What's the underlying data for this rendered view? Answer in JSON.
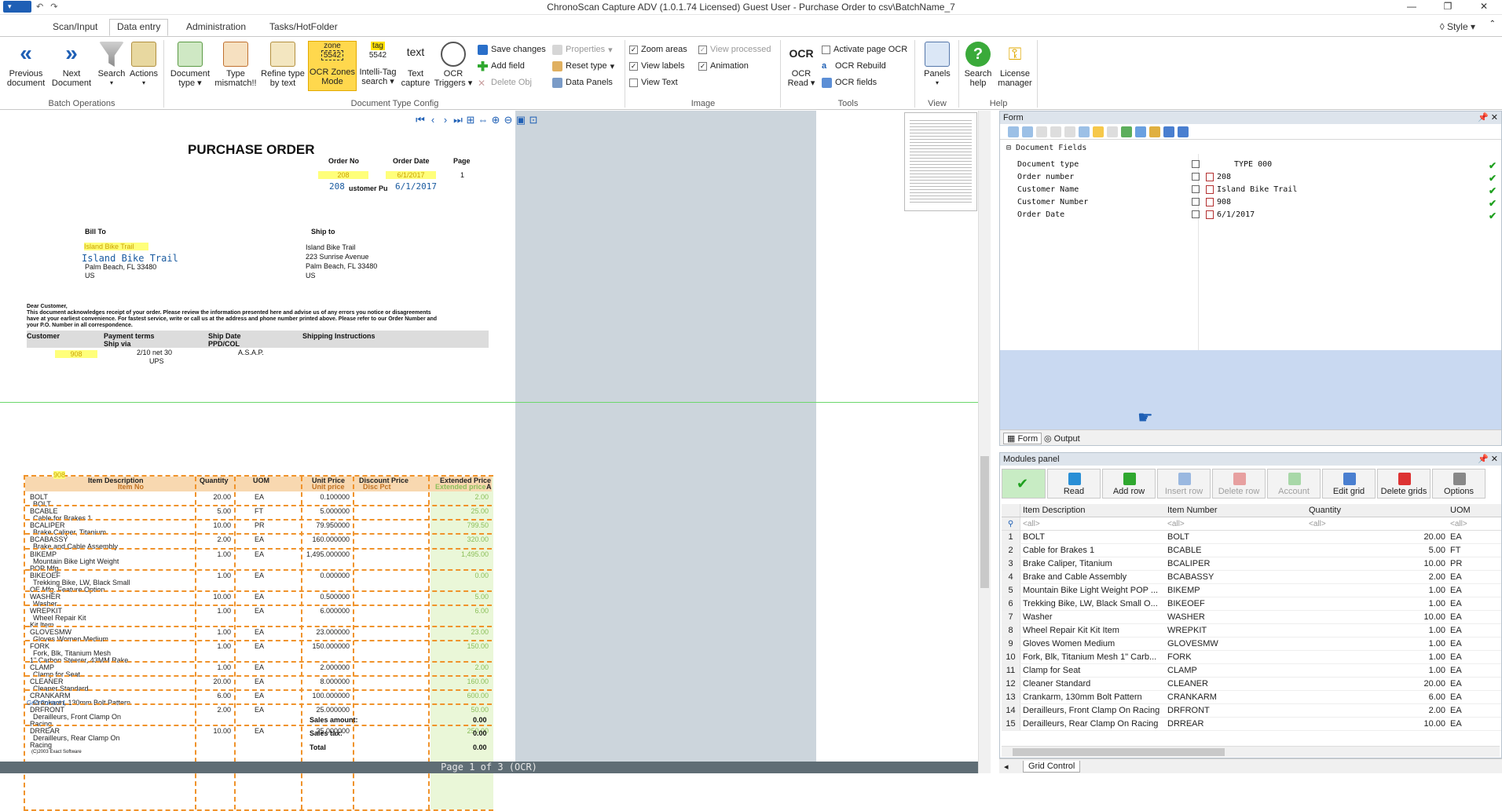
{
  "window": {
    "title": "ChronoScan Capture ADV (1.0.1.74 Licensed) Guest User  - Purchase Order to csv\\BatchName_7",
    "style_label": "Style"
  },
  "tabs": [
    "Scan/Input",
    "Data entry",
    "Administration",
    "Tasks/HotFolder"
  ],
  "ribbon": {
    "buttons": [
      {
        "label": "Previous\ndocument",
        "icon": "left-arrows-icon"
      },
      {
        "label": "Next\nDocument",
        "icon": "right-arrows-icon"
      },
      {
        "label": "Search",
        "icon": "funnel-icon"
      },
      {
        "label": "Actions",
        "icon": "actions-icon"
      },
      {
        "label": "Document\ntype",
        "icon": "doc-type-icon"
      },
      {
        "label": "Type\nmismatch!!",
        "icon": "mismatch-icon"
      },
      {
        "label": "Refine type\nby text",
        "icon": "refine-icon"
      },
      {
        "label": "OCR Zones\nMode",
        "icon": "zone-icon"
      },
      {
        "label": "Intelli-Tag\nsearch",
        "icon": "tag-icon"
      },
      {
        "label": "Text\ncapture",
        "icon": "text-icon"
      },
      {
        "label": "OCR\nTriggers",
        "icon": "triggers-icon"
      },
      {
        "label": "OCR\nRead",
        "icon": "ocr-icon"
      },
      {
        "label": "Panels",
        "icon": "panels-icon"
      },
      {
        "label": "Search\nhelp",
        "icon": "help-icon"
      },
      {
        "label": "License\nmanager",
        "icon": "key-icon"
      }
    ],
    "zone_icon_text": {
      "top": "zone",
      "mid": "5542"
    },
    "tag_icon_text": {
      "top": "tag",
      "mid": "5542"
    },
    "text_icon_text": "text",
    "ocr_icon_text": "OCR",
    "small": {
      "save": "Save changes",
      "add_field": "Add field",
      "delete_obj": "Delete Obj",
      "properties": "Properties",
      "reset_type": "Reset type",
      "data_panels": "Data Panels",
      "zoom_areas": "Zoom areas",
      "view_processed": "View processed",
      "view_labels": "View labels",
      "animation": "Animation",
      "view_text": "View Text",
      "activate_ocr": "Activate page OCR",
      "ocr_rebuild": "OCR Rebuild",
      "ocr_fields": "OCR fields"
    },
    "groups": [
      "Batch Operations",
      "Document Type Config",
      "Image",
      "Tools",
      "View",
      "Help"
    ]
  },
  "doc": {
    "title": "PURCHASE ORDER",
    "hdr": {
      "order_no": "Order No",
      "order_date": "Order Date",
      "page": "Page",
      "order_no_val": "208",
      "order_date_val": "6/1/2017",
      "page_val": "1",
      "order_no_ocr": "208",
      "order_date_ocr": "6/1/2017",
      "customer_po": "ustomer Pu"
    },
    "bill_to": "Bill To",
    "ship_to": "Ship to",
    "bill_name_hl": "Island Bike Trail",
    "bill_name_ocr": "Island Bike Trail",
    "bill_addr": [
      "Palm Beach, FL 33480",
      "US"
    ],
    "ship_addr": [
      "Island Bike Trail",
      "223 Sunrise Avenue",
      "Palm Beach, FL 33480",
      "US"
    ],
    "letter": [
      "Dear Customer,",
      "This document acknowledges receipt of your order. Please review the information presented here and advise us of any errors you notice or disagreements",
      "have at your earliest convenience. For fastest service, write or call us at the address and phone number printed above. Please refer to our Order Number and",
      "your P.O. Number in all correspondence."
    ],
    "terms": {
      "customer": "Customer",
      "payment": "Payment terms",
      "shipvia": "Ship via",
      "shipdate": "Ship Date",
      "ppd": "PPD/COL",
      "instr": "Shipping Instructions",
      "cust_val": "908",
      "payment_val": "2/10 net 30",
      "shipvia_val": "UPS",
      "asap": "A.S.A.P."
    },
    "cols": [
      "Item No",
      "Item Description",
      "Quantity",
      "UOM",
      "Unit Price",
      "Unit price",
      "Discount Price",
      "Disc Pct",
      "Extended Price",
      "Extended price"
    ],
    "items": [
      {
        "no": "BOLT",
        "desc": "BOLT",
        "qty": "20.00",
        "uom": "EA",
        "price": "0.100000",
        "ext": "2.00"
      },
      {
        "no": "BCABLE",
        "desc": "Cable for Brakes 1",
        "qty": "5.00",
        "uom": "FT",
        "price": "5.000000",
        "ext": "25.00"
      },
      {
        "no": "BCALIPER",
        "desc": "Brake Caliper, Titanium",
        "qty": "10.00",
        "uom": "PR",
        "price": "79.950000",
        "ext": "799.50"
      },
      {
        "no": "BCABASSY",
        "desc": "Brake and Cable Assembly",
        "qty": "2.00",
        "uom": "EA",
        "price": "160.000000",
        "ext": "320.00"
      },
      {
        "no": "BIKEMP",
        "desc": "Mountain Bike Light Weight",
        "desc2": "POP Mfg.",
        "qty": "1.00",
        "uom": "EA",
        "price": "1,495.000000",
        "ext": "1,495.00"
      },
      {
        "no": "BIKEOEF",
        "desc": "Trekking Bike, LW, Black Small",
        "desc2": "OE Mfg. Feature Option",
        "qty": "1.00",
        "uom": "EA",
        "price": "0.000000",
        "ext": "0.00"
      },
      {
        "no": "WASHER",
        "desc": "Washer",
        "qty": "10.00",
        "uom": "EA",
        "price": "0.500000",
        "ext": "5.00"
      },
      {
        "no": "WREPKIT",
        "desc": "Wheel Repair Kit",
        "desc2": "Kit Item",
        "qty": "1.00",
        "uom": "EA",
        "price": "6.000000",
        "ext": "6.00"
      },
      {
        "no": "GLOVESMW",
        "desc": "Gloves Women Medium",
        "qty": "1.00",
        "uom": "EA",
        "price": "23.000000",
        "ext": "23.00"
      },
      {
        "no": "FORK",
        "desc": "Fork, Blk, Titanium Mesh",
        "desc2": "1\" Carbon Steerer, 43MM Rake",
        "qty": "1.00",
        "uom": "EA",
        "price": "150.000000",
        "ext": "150.00"
      },
      {
        "no": "CLAMP",
        "desc": "Clamp for Seat",
        "qty": "1.00",
        "uom": "EA",
        "price": "2.000000",
        "ext": "2.00"
      },
      {
        "no": "CLEANER",
        "desc": "Cleaner Standard",
        "qty": "20.00",
        "uom": "EA",
        "price": "8.000000",
        "ext": "160.00"
      },
      {
        "no": "CRANKARM",
        "desc": "Crankarm, 130mm Bolt Pattern",
        "qty": "6.00",
        "uom": "EA",
        "price": "100.000000",
        "ext": "600.00"
      },
      {
        "no": "DRFRONT",
        "desc": "Derailleurs, Front Clamp On",
        "desc2": "Racing",
        "qty": "2.00",
        "uom": "EA",
        "price": "25.000000",
        "ext": "50.00"
      },
      {
        "no": "DRREAR",
        "desc": "Derailleurs, Rear Clamp On",
        "desc2": "Racing",
        "qty": "10.00",
        "uom": "EA",
        "price": "25.000000",
        "ext": "250.00"
      }
    ],
    "grid_label": "Grid Control 1",
    "totals": [
      {
        "k": "Sales amount:",
        "v": "0.00"
      },
      {
        "k": "Sales tax:",
        "v": "0.00"
      },
      {
        "k": "Total",
        "v": "0.00"
      }
    ],
    "copyright": "(C)2003 Exact Software",
    "header_item_hl": "908",
    "grid_anchor": "A"
  },
  "pagebar": "Page 1 of 3 (OCR)",
  "form": {
    "title": "Form",
    "section": "Document Fields",
    "fields": [
      {
        "name": "Document type",
        "value": "TYPE 000"
      },
      {
        "name": "Order number",
        "value": "208"
      },
      {
        "name": "Customer Name",
        "value": "Island Bike Trail"
      },
      {
        "name": "Customer Number",
        "value": "908"
      },
      {
        "name": "Order Date",
        "value": "6/1/2017"
      }
    ],
    "tabs": [
      "Form",
      "Output"
    ]
  },
  "modules": {
    "title": "Modules panel",
    "buttons": [
      "Read",
      "Add row",
      "Insert row",
      "Delete row",
      "Account",
      "Edit grid",
      "Delete grids",
      "Options"
    ],
    "columns": [
      "Item Description",
      "Item Number",
      "Quantity",
      "UOM"
    ],
    "filter": "<all>",
    "rows": [
      [
        "1",
        "BOLT",
        "BOLT",
        "20.00",
        "EA"
      ],
      [
        "2",
        "Cable for Brakes 1",
        "BCABLE",
        "5.00",
        "FT"
      ],
      [
        "3",
        "Brake Caliper, Titanium",
        "BCALIPER",
        "10.00",
        "PR"
      ],
      [
        "4",
        "Brake and Cable Assembly",
        "BCABASSY",
        "2.00",
        "EA"
      ],
      [
        "5",
        "Mountain Bike Light Weight  POP ...",
        "BIKEMP",
        "1.00",
        "EA"
      ],
      [
        "6",
        "Trekking Bike, LW, Black Small  O...",
        "BIKEOEF",
        "1.00",
        "EA"
      ],
      [
        "7",
        "Washer",
        "WASHER",
        "10.00",
        "EA"
      ],
      [
        "8",
        "Wheel Repair Kit  Kit Item",
        "WREPKIT",
        "1.00",
        "EA"
      ],
      [
        "9",
        "Gloves Women Medium",
        "GLOVESMW",
        "1.00",
        "EA"
      ],
      [
        "10",
        "Fork, Blk, Titanium Mesh  1\" Carb...",
        "FORK",
        "1.00",
        "EA"
      ],
      [
        "11",
        "Clamp for Seat",
        "CLAMP",
        "1.00",
        "EA"
      ],
      [
        "12",
        "Cleaner Standard",
        "CLEANER",
        "20.00",
        "EA"
      ],
      [
        "13",
        "Crankarm, 130mm Bolt Pattern",
        "CRANKARM",
        "6.00",
        "EA"
      ],
      [
        "14",
        "Derailleurs, Front Clamp On  Racing",
        "DRFRONT",
        "2.00",
        "EA"
      ],
      [
        "15",
        "Derailleurs, Rear Clamp On  Racing",
        "DRREAR",
        "10.00",
        "EA"
      ]
    ],
    "bottom_tab": "Grid Control"
  },
  "colors": {
    "accent": "#1e5fb5",
    "zone": "#f0932b",
    "highlight": "#ffff7a",
    "ok": "#1ea01e"
  }
}
